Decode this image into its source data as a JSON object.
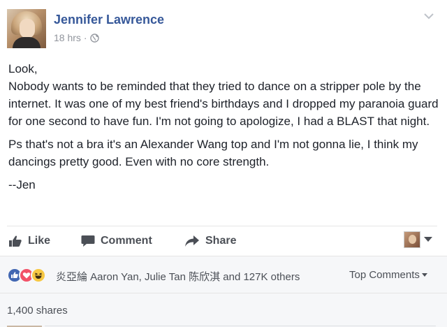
{
  "post": {
    "author": "Jennifer Lawrence",
    "timestamp": "18 hrs",
    "separator": "·",
    "privacy_icon": "globe-icon",
    "paragraphs": [
      "Look,\nNobody wants to be reminded that they tried to dance on a stripper pole by the internet. It was one of my best friend's birthdays and I dropped my paranoia guard for one second to have fun. I'm not going to apologize, I had a BLAST that night.",
      "Ps that's not a bra it's an Alexander Wang top and I'm not gonna lie, I think my dancings pretty good. Even with no core strength.",
      "--Jen"
    ]
  },
  "actions": {
    "like_label": "Like",
    "comment_label": "Comment",
    "share_label": "Share"
  },
  "reactions": {
    "icons": [
      "like-reaction-icon",
      "love-reaction-icon",
      "haha-reaction-icon"
    ],
    "summary": "炎亞綸 Aaron Yan, Julie Tan 陈欣淇 and 127K others",
    "sort_label": "Top Comments"
  },
  "shares": {
    "label": "1,400 shares"
  },
  "colors": {
    "name_blue": "#365899",
    "like_blue": "#4267b2",
    "love_red": "#f25268",
    "haha_yellow": "#f7c843",
    "secondary_gray": "#90949c",
    "panel_bg": "#f6f7f9"
  }
}
